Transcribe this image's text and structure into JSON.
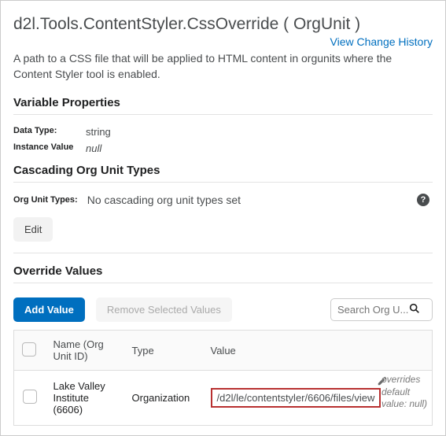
{
  "title": "d2l.Tools.ContentStyler.CssOverride ( OrgUnit )",
  "history_link": "View Change History",
  "description": "A path to a CSS file that will be applied to HTML content in orgunits where the Content Styler tool is enabled.",
  "sections": {
    "variable_properties": "Variable Properties",
    "cascading": "Cascading Org Unit Types",
    "override": "Override Values"
  },
  "properties": {
    "data_type_label": "Data Type:",
    "data_type_value": "string",
    "instance_value_label": "Instance Value",
    "instance_value_value": "null"
  },
  "cascading": {
    "label": "Org Unit Types:",
    "value": "No cascading org unit types set",
    "edit_label": "Edit"
  },
  "toolbar": {
    "add_value": "Add Value",
    "remove_selected": "Remove Selected Values",
    "search_placeholder": "Search Org U..."
  },
  "table": {
    "headers": {
      "name": "Name (Org Unit ID)",
      "type": "Type",
      "value": "Value"
    },
    "rows": [
      {
        "name": "Lake Valley Institute (6606)",
        "type": "Organization",
        "value": "/d2l/le/contentstyler/6606/files/view",
        "override_note": "overrides default value: null)"
      }
    ]
  }
}
